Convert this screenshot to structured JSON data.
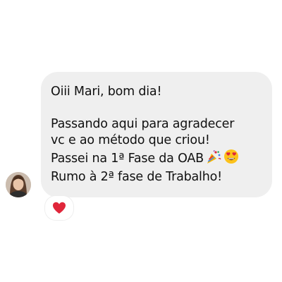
{
  "message": {
    "line1": "Oiii Mari, bom dia!",
    "line2": "Passando aqui para agradecer",
    "line3": "vc e ao método que criou!",
    "line4": "Passei na 1ª Fase da OAB",
    "line5": "Rumo à 2ª fase de Trabalho!",
    "emojis": [
      "party-popper-icon",
      "heart-eyes-icon"
    ]
  },
  "reaction": {
    "icon": "heart-icon",
    "color": "#e0263a"
  },
  "colors": {
    "bubble": "#efefef",
    "text": "#111111"
  }
}
